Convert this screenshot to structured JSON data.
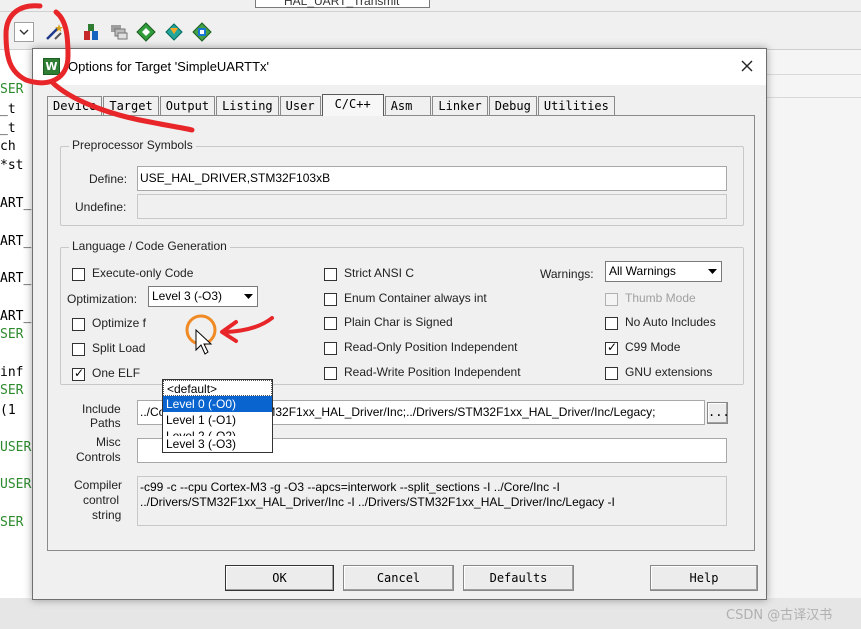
{
  "ide": {
    "toolbar_top_text": "HAL_UART_Transmit",
    "toolbar_icons": [
      "dropdown-icon",
      "magic-wand-icon",
      "target-icon",
      "manage-icon",
      "load-icon",
      "diamond-icon",
      "component-icon"
    ],
    "code_fragments": [
      "SER",
      "_t",
      "_t",
      "ch",
      "*st",
      "ART_",
      "ART_",
      "ART_",
      "ART_",
      "SER",
      "inf",
      "SER",
      "(1",
      "USER",
      "USER",
      "SER"
    ],
    "watermark": "CSDN @古译汉书"
  },
  "dialog": {
    "title": "Options for Target 'SimpleUARTTx'",
    "tabs": [
      "Device",
      "Target",
      "Output",
      "Listing",
      "User",
      "C/C++",
      "Asm",
      "Linker",
      "Debug",
      "Utilities"
    ],
    "active_tab": "C/C++",
    "preprocessor": {
      "group_title": "Preprocessor Symbols",
      "define_label": "Define:",
      "define_value": "USE_HAL_DRIVER,STM32F103xB",
      "undefine_label": "Undefine:",
      "undefine_value": ""
    },
    "language": {
      "group_title": "Language / Code Generation",
      "execute_only": {
        "label": "Execute-only Code",
        "checked": false
      },
      "optimization_label": "Optimization:",
      "optimization_value": "Level 3 (-O3)",
      "optimization_options": [
        "<default>",
        "Level 0 (-O0)",
        "Level 1 (-O1)",
        "Level 2 (-O2)",
        "Level 3 (-O3)"
      ],
      "optimization_highlighted": "Level 0 (-O0)",
      "optimize_for_time": {
        "label": "Optimize f",
        "checked": false
      },
      "split_load": {
        "label": "Split Load",
        "checked": false
      },
      "one_elf": {
        "label": "One ELF",
        "checked": true
      },
      "strict_ansi": {
        "label": "Strict ANSI C",
        "checked": false
      },
      "enum_container": {
        "label": "Enum Container always int",
        "checked": false
      },
      "plain_char": {
        "label": "Plain Char is Signed",
        "checked": false
      },
      "ro_pi": {
        "label": "Read-Only Position Independent",
        "checked": false
      },
      "rw_pi": {
        "label": "Read-Write Position Independent",
        "checked": false
      },
      "warnings_label": "Warnings:",
      "warnings_value": "All Warnings",
      "thumb_mode": {
        "label": "Thumb Mode",
        "checked": false,
        "disabled": true
      },
      "no_auto_includes": {
        "label": "No Auto Includes",
        "checked": false
      },
      "c99_mode": {
        "label": "C99 Mode",
        "checked": true
      },
      "gnu_extensions": {
        "label": "GNU extensions",
        "checked": false
      }
    },
    "include_paths": {
      "label_1": "Include",
      "label_2": "Paths",
      "value": "../Core/Inc;../Drivers/STM32F1xx_HAL_Driver/Inc;../Drivers/STM32F1xx_HAL_Driver/Inc/Legacy;",
      "browse": "..."
    },
    "misc_controls": {
      "label_1": "Misc",
      "label_2": "Controls",
      "value": ""
    },
    "compiler_control": {
      "label_1": "Compiler",
      "label_2": "control",
      "label_3": "string",
      "line_1": "-c99 -c --cpu Cortex-M3 -g -O3 --apcs=interwork --split_sections -I ../Core/Inc -I",
      "line_2": "../Drivers/STM32F1xx_HAL_Driver/Inc -I ../Drivers/STM32F1xx_HAL_Driver/Inc/Legacy -I"
    },
    "buttons": {
      "ok": "OK",
      "cancel": "Cancel",
      "defaults": "Defaults",
      "help": "Help"
    }
  },
  "colors": {
    "annotation_red": "#e8262a",
    "annotation_orange": "#f08a24",
    "selection_blue": "#0a64d0"
  }
}
